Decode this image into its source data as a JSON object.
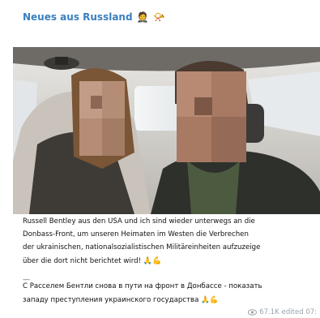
{
  "channel": {
    "name": "Neues aus Russland",
    "emoji_figure": "🤵",
    "emoji_horn": "📯"
  },
  "post": {
    "photo_icon": "selfie-photo-in-car-blurred-faces",
    "caption_de": [
      "Russell Bentley aus den USA und ich sind wieder unterwegs an die",
      "Donbass-Front, um unseren Heimaten im Westen die Verbrechen",
      "der ukrainischen, nationalsozialistischen Militäreinheiten aufzuzeige",
      "über die dort nicht berichtet wird!"
    ],
    "caption_de_emoji": "🙏💪",
    "separator": "—",
    "caption_ru": [
      "С Расселем Бентли снова в пути на фронт в Донбассе - показать",
      "западу преступления украинского государства"
    ],
    "caption_ru_emoji": "🙏💪",
    "views_icon": "eye-icon",
    "views": "67.1K",
    "edited": "edited 07:"
  },
  "colors": {
    "channel_name": "#3a7fbf",
    "text": "#111111",
    "meta": "#9aa3ab"
  }
}
